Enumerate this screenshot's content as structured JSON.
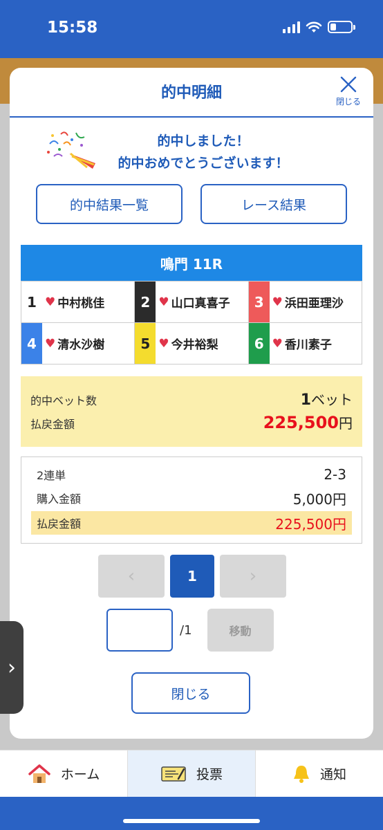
{
  "status_bar": {
    "time": "15:58"
  },
  "modal": {
    "title": "的中明細",
    "close_label": "閉じる",
    "congrats_line1": "的中しました！",
    "congrats_line2": "的中おめでとうございます！",
    "links": {
      "hit_list": "的中結果一覧",
      "race_result": "レース結果"
    },
    "race": {
      "name": "鳴門 11R"
    },
    "racers": [
      {
        "num": "1",
        "name": "中村桃佳",
        "num_bg": "#ffffff",
        "num_color": "#222222"
      },
      {
        "num": "2",
        "name": "山口真喜子",
        "num_bg": "#2b2b2b",
        "num_color": "#ffffff"
      },
      {
        "num": "3",
        "name": "浜田亜理沙",
        "num_bg": "#ee5a5a",
        "num_color": "#ffffff"
      },
      {
        "num": "4",
        "name": "清水沙樹",
        "num_bg": "#3b82e8",
        "num_color": "#ffffff"
      },
      {
        "num": "5",
        "name": "今井裕梨",
        "num_bg": "#f4dc2e",
        "num_color": "#222222"
      },
      {
        "num": "6",
        "name": "香川素子",
        "num_bg": "#1f9d4c",
        "num_color": "#ffffff"
      }
    ],
    "summary": {
      "bet_label": "的中ベット数",
      "bet_count": "1",
      "bet_unit": "ベット",
      "payout_label": "払戻金額",
      "payout_value": "225,500",
      "yen": "円"
    },
    "detail": {
      "bet_type": "2連単",
      "combination": "2-3",
      "purchase_label": "購入金額",
      "purchase_value": "5,000円",
      "payout_label": "払戻金額",
      "payout_value": "225,500円"
    },
    "pager": {
      "prev": "‹",
      "current": "1",
      "next": "›"
    },
    "goto": {
      "input_value": "",
      "total": "/1",
      "move_label": "移動"
    },
    "close_button": "閉じる"
  },
  "side_handle": {
    "icon": "chevron-right",
    "glyph": "›"
  },
  "tabbar": {
    "tabs": [
      {
        "label": "ホーム",
        "icon": "home-icon"
      },
      {
        "label": "投票",
        "icon": "ticket-icon",
        "active": true
      },
      {
        "label": "通知",
        "icon": "bell-icon"
      }
    ]
  },
  "colors": {
    "primary": "#2a62c4",
    "race_bar": "#1e88e5",
    "payout_red": "#e8101c",
    "summary_bg": "#fbefae"
  }
}
